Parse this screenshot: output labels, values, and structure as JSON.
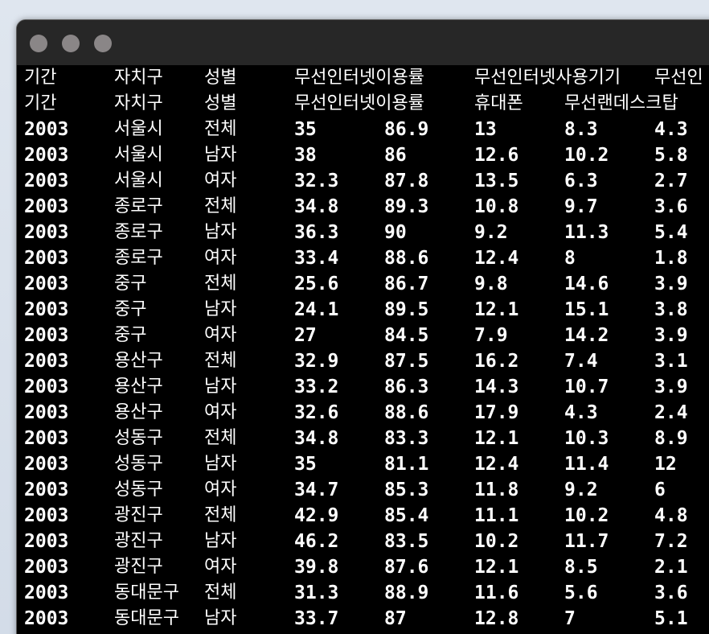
{
  "window": {
    "title": ""
  },
  "header": {
    "row1": [
      "기간",
      "자치구",
      "성별",
      "무선인터넷이용률",
      "무선인터넷사용기기",
      "무선인"
    ],
    "row2": [
      "기간",
      "자치구",
      "성별",
      "무선인터넷이용률",
      "휴대폰",
      "무선랜데스크탑"
    ]
  },
  "rows": [
    [
      "2003",
      "서울시",
      "전체",
      "35",
      "86.9",
      "13",
      "8.3",
      "4.3"
    ],
    [
      "2003",
      "서울시",
      "남자",
      "38",
      "86",
      "12.6",
      "10.2",
      "5.8"
    ],
    [
      "2003",
      "서울시",
      "여자",
      "32.3",
      "87.8",
      "13.5",
      "6.3",
      "2.7"
    ],
    [
      "2003",
      "종로구",
      "전체",
      "34.8",
      "89.3",
      "10.8",
      "9.7",
      "3.6"
    ],
    [
      "2003",
      "종로구",
      "남자",
      "36.3",
      "90",
      "9.2",
      "11.3",
      "5.4"
    ],
    [
      "2003",
      "종로구",
      "여자",
      "33.4",
      "88.6",
      "12.4",
      "8",
      "1.8"
    ],
    [
      "2003",
      "중구",
      "전체",
      "25.6",
      "86.7",
      "9.8",
      "14.6",
      "3.9"
    ],
    [
      "2003",
      "중구",
      "남자",
      "24.1",
      "89.5",
      "12.1",
      "15.1",
      "3.8"
    ],
    [
      "2003",
      "중구",
      "여자",
      "27",
      "84.5",
      "7.9",
      "14.2",
      "3.9"
    ],
    [
      "2003",
      "용산구",
      "전체",
      "32.9",
      "87.5",
      "16.2",
      "7.4",
      "3.1"
    ],
    [
      "2003",
      "용산구",
      "남자",
      "33.2",
      "86.3",
      "14.3",
      "10.7",
      "3.9"
    ],
    [
      "2003",
      "용산구",
      "여자",
      "32.6",
      "88.6",
      "17.9",
      "4.3",
      "2.4"
    ],
    [
      "2003",
      "성동구",
      "전체",
      "34.8",
      "83.3",
      "12.1",
      "10.3",
      "8.9"
    ],
    [
      "2003",
      "성동구",
      "남자",
      "35",
      "81.1",
      "12.4",
      "11.4",
      "12"
    ],
    [
      "2003",
      "성동구",
      "여자",
      "34.7",
      "85.3",
      "11.8",
      "9.2",
      "6"
    ],
    [
      "2003",
      "광진구",
      "전체",
      "42.9",
      "85.4",
      "11.1",
      "10.2",
      "4.8"
    ],
    [
      "2003",
      "광진구",
      "남자",
      "46.2",
      "83.5",
      "10.2",
      "11.7",
      "7.2"
    ],
    [
      "2003",
      "광진구",
      "여자",
      "39.8",
      "87.6",
      "12.1",
      "8.5",
      "2.1"
    ],
    [
      "2003",
      "동대문구",
      "전체",
      "31.3",
      "88.9",
      "11.6",
      "5.6",
      "3.6"
    ],
    [
      "2003",
      "동대문구",
      "남자",
      "33.7",
      "87",
      "12.8",
      "7",
      "5.1"
    ]
  ],
  "colors": {
    "terminal_bg": "#000000",
    "titlebar_bg": "#272727",
    "text": "#ffffff",
    "traffic_light": "#8a8687"
  }
}
